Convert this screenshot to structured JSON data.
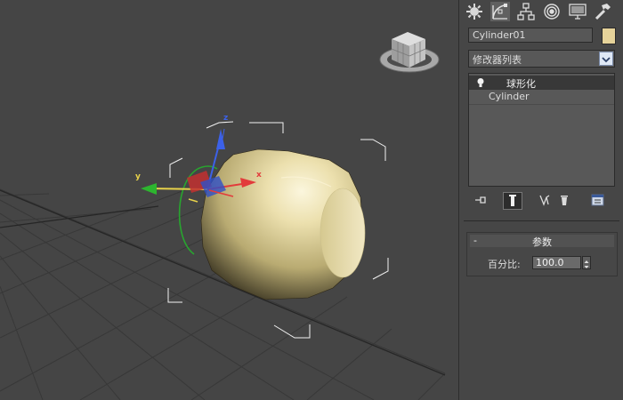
{
  "object": {
    "name": "Cylinder01",
    "color": "#e6d39a"
  },
  "modifier_list": {
    "label": "修改器列表"
  },
  "stack": {
    "items": [
      {
        "label": "球形化",
        "icon": "lightbulb-icon"
      },
      {
        "label": "Cylinder"
      }
    ]
  },
  "tabs": [
    {
      "icon": "create-icon"
    },
    {
      "icon": "modify-icon"
    },
    {
      "icon": "hierarchy-icon"
    },
    {
      "icon": "motion-icon"
    },
    {
      "icon": "display-icon"
    },
    {
      "icon": "utilities-icon"
    }
  ],
  "stack_tools": [
    {
      "icon": "pin-stack-icon"
    },
    {
      "icon": "show-end-result-icon"
    },
    {
      "icon": "make-unique-icon"
    },
    {
      "icon": "remove-modifier-icon"
    },
    {
      "icon": "configure-modifier-sets-icon"
    }
  ],
  "parameters": {
    "title": "参数",
    "collapse": "-",
    "percent_label": "百分比:",
    "percent_value": "100.0"
  },
  "gizmo": {
    "x_label": "x",
    "y_label": "y",
    "z_label": "z"
  }
}
